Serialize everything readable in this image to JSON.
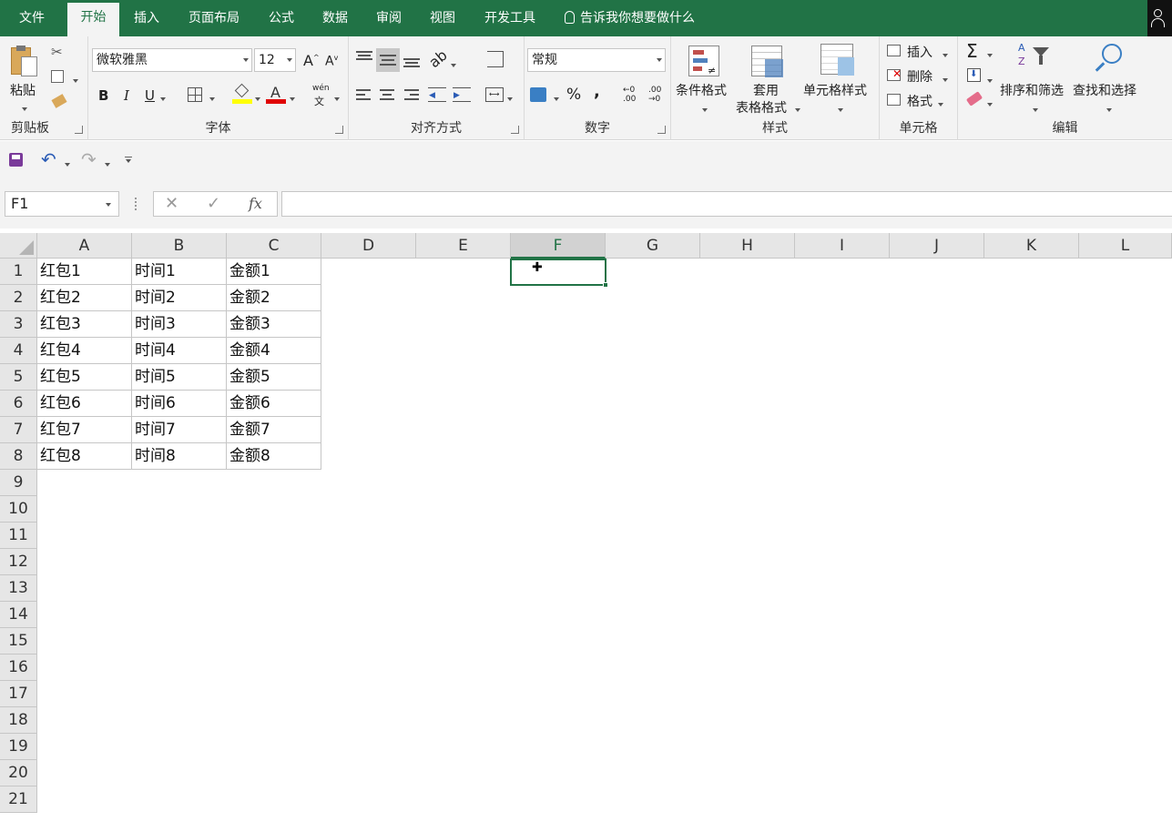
{
  "tabs": [
    "文件",
    "开始",
    "插入",
    "页面布局",
    "公式",
    "数据",
    "审阅",
    "视图",
    "开发工具"
  ],
  "active_tab": "开始",
  "tell_me": "告诉我你想要做什么",
  "ribbon": {
    "clipboard": {
      "label": "剪贴板",
      "paste": "粘贴"
    },
    "font": {
      "label": "字体",
      "font_name": "微软雅黑",
      "font_size": "12",
      "bold": "B",
      "italic": "I",
      "underline": "U",
      "phonetic": "wén"
    },
    "alignment": {
      "label": "对齐方式"
    },
    "number": {
      "label": "数字",
      "format": "常规",
      "percent": "%",
      "comma": ","
    },
    "styles": {
      "label": "样式",
      "conditional": "条件格式",
      "table_format_1": "套用",
      "table_format_2": "表格格式",
      "cell_styles": "单元格样式"
    },
    "cells": {
      "label": "单元格",
      "insert": "插入",
      "delete": "删除",
      "format": "格式"
    },
    "editing": {
      "label": "编辑",
      "sort_filter": "排序和筛选",
      "find_select": "查找和选择"
    }
  },
  "name_box": "F1",
  "fx": "fx",
  "formula": "",
  "columns": [
    "A",
    "B",
    "C",
    "D",
    "E",
    "F",
    "G",
    "H",
    "I",
    "J",
    "K",
    "L"
  ],
  "selected_column": "F",
  "rows": [
    "1",
    "2",
    "3",
    "4",
    "5",
    "6",
    "7",
    "8",
    "9",
    "10",
    "11",
    "12",
    "13",
    "14",
    "15",
    "16",
    "17",
    "18",
    "19",
    "20",
    "21"
  ],
  "data": [
    [
      "红包1",
      "时间1",
      "金额1"
    ],
    [
      "红包2",
      "时间2",
      "金额2"
    ],
    [
      "红包3",
      "时间3",
      "金额3"
    ],
    [
      "红包4",
      "时间4",
      "金额4"
    ],
    [
      "红包5",
      "时间5",
      "金额5"
    ],
    [
      "红包6",
      "时间6",
      "金额6"
    ],
    [
      "红包7",
      "时间7",
      "金额7"
    ],
    [
      "红包8",
      "时间8",
      "金额8"
    ]
  ],
  "colors": {
    "accent": "#217346",
    "ribbon": "#f3f3f3",
    "header": "#e6e6e6",
    "grid": "#c6c6c6"
  }
}
